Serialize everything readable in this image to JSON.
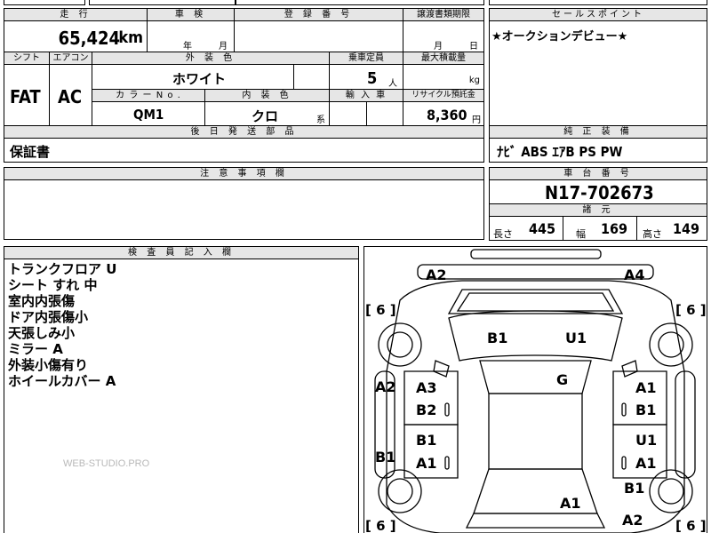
{
  "top_row": {
    "cut1": "",
    "cut2": "",
    "cut3": ""
  },
  "mileage": {
    "label": "走 行",
    "value": "65,424",
    "unit": "km"
  },
  "inspection": {
    "label": "車 検",
    "year": "年",
    "month": "月"
  },
  "registration": {
    "label": "登 録 番 号"
  },
  "transfer": {
    "label": "譲渡書類期限",
    "month": "月",
    "day": "日"
  },
  "sales_point": {
    "label": "セールスポイント",
    "text": "★オークションデビュー★"
  },
  "shift": {
    "label": "シフト",
    "value": "FAT"
  },
  "aircon": {
    "label": "エアコン",
    "value": "AC"
  },
  "exterior_color": {
    "label": "外 装 色",
    "value": "ホワイト"
  },
  "capacity": {
    "label": "乗車定員",
    "value": "5",
    "unit": "人"
  },
  "max_load": {
    "label": "最大積載量",
    "unit": "kg"
  },
  "color_no": {
    "label": "カ ラ ー N o .",
    "value": "QM1"
  },
  "interior_color": {
    "label": "内 装 色",
    "value": "クロ",
    "suffix": "系"
  },
  "import": {
    "label": "輸 入 車"
  },
  "recycle": {
    "label": "リサイクル預託金",
    "value": "8,360",
    "unit": "円"
  },
  "later_parts": {
    "label": "後 日 発 送 部 品",
    "value": "保証書"
  },
  "genuine_equipment": {
    "label": "純 正 装 備",
    "value": "ﾅﾋﾞ ABS ｴｱB PS PW"
  },
  "notes": {
    "label": "注 意 事 項 欄"
  },
  "chassis": {
    "label": "車 台 番 号",
    "value": "N17-702673"
  },
  "specs": {
    "label": "諸 元",
    "length_label": "長さ",
    "length": "445",
    "width_label": "幅",
    "width": "169",
    "height_label": "高さ",
    "height": "149"
  },
  "inspector": {
    "label": "検 査 員 記 入 欄",
    "lines": [
      "トランクフロア U",
      "シート すれ 中",
      "室内内張傷",
      "ドア内張傷小",
      "天張しみ小",
      "ミラー A",
      "外装小傷有り",
      "ホイールカバー A"
    ]
  },
  "watermark": "WEB-STUDIO.PRO",
  "diagram_marks": {
    "tl": "A2",
    "tr": "A4",
    "b1_roof": "B1",
    "u1_roof": "U1",
    "g": "G",
    "l_a3": "A3",
    "l_b2": "B2",
    "l_b1": "B1",
    "l_a1": "A1",
    "r_a1": "A1",
    "r_b1": "B1",
    "r_u1": "U1",
    "r_a1b": "A1",
    "side_l_a2": "A2",
    "side_l_b1": "B1",
    "rear_b1": "B1",
    "bottom_a1": "A1",
    "bottom_a2": "A2",
    "tire_fl": "[ 6 ]",
    "tire_fr": "[ 6 ]",
    "tire_rl": "[ 6 ]",
    "tire_rr": "[ 6 ]"
  }
}
